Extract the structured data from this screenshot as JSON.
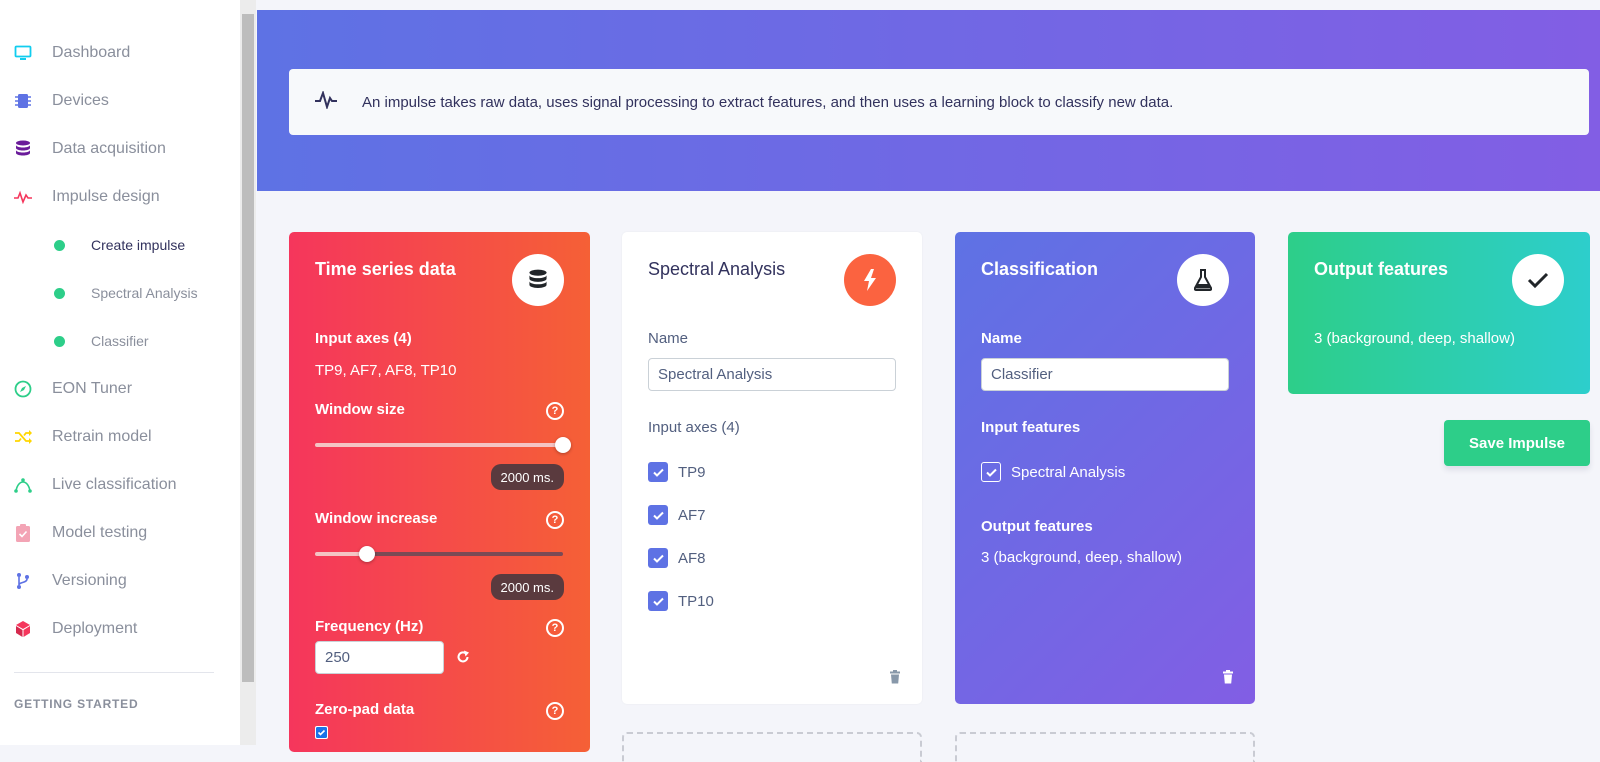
{
  "sidebar": {
    "items": [
      {
        "label": "Dashboard",
        "icon": "monitor-icon",
        "color": "#11cdef"
      },
      {
        "label": "Devices",
        "icon": "chip-icon",
        "color": "#5e72e4"
      },
      {
        "label": "Data acquisition",
        "icon": "database-icon",
        "color": "#6a1b9a"
      },
      {
        "label": "Impulse design",
        "icon": "pulse-icon",
        "color": "#f5365c"
      },
      {
        "label": "EON Tuner",
        "icon": "compass-icon",
        "color": "#2dce89"
      },
      {
        "label": "Retrain model",
        "icon": "shuffle-icon",
        "color": "#ffd600"
      },
      {
        "label": "Live classification",
        "icon": "bezier-icon",
        "color": "#2dce89"
      },
      {
        "label": "Model testing",
        "icon": "clipboard-check-icon",
        "color": "#f3a4b5"
      },
      {
        "label": "Versioning",
        "icon": "branch-icon",
        "color": "#5e72e4"
      },
      {
        "label": "Deployment",
        "icon": "cube-icon",
        "color": "#f5365c"
      }
    ],
    "sub_items": [
      {
        "label": "Create impulse",
        "active": true
      },
      {
        "label": "Spectral Analysis",
        "active": false
      },
      {
        "label": "Classifier",
        "active": false
      }
    ],
    "section_title": "GETTING STARTED"
  },
  "banner": {
    "info_text": "An impulse takes raw data, uses signal processing to extract features, and then uses a learning block to classify new data."
  },
  "time_series": {
    "title": "Time series data",
    "input_axes_label": "Input axes (4)",
    "input_axes_value": "TP9, AF7, AF8, TP10",
    "window_size_label": "Window size",
    "window_size_value": "2000 ms.",
    "window_size_fraction": 1.0,
    "window_increase_label": "Window increase",
    "window_increase_value": "2000 ms.",
    "window_increase_fraction": 0.21,
    "frequency_label": "Frequency (Hz)",
    "frequency_value": "250",
    "zero_pad_label": "Zero-pad data",
    "zero_pad_checked": true
  },
  "spectral": {
    "title": "Spectral Analysis",
    "name_label": "Name",
    "name_value": "Spectral Analysis",
    "input_axes_label": "Input axes (4)",
    "axes": [
      "TP9",
      "AF7",
      "AF8",
      "TP10"
    ]
  },
  "classification": {
    "title": "Classification",
    "name_label": "Name",
    "name_value": "Classifier",
    "input_features_label": "Input features",
    "input_feature": "Spectral Analysis",
    "output_features_label": "Output features",
    "output_features_value": "3 (background, deep, shallow)"
  },
  "output": {
    "title": "Output features",
    "value": "3 (background, deep, shallow)"
  },
  "save_button": "Save Impulse"
}
